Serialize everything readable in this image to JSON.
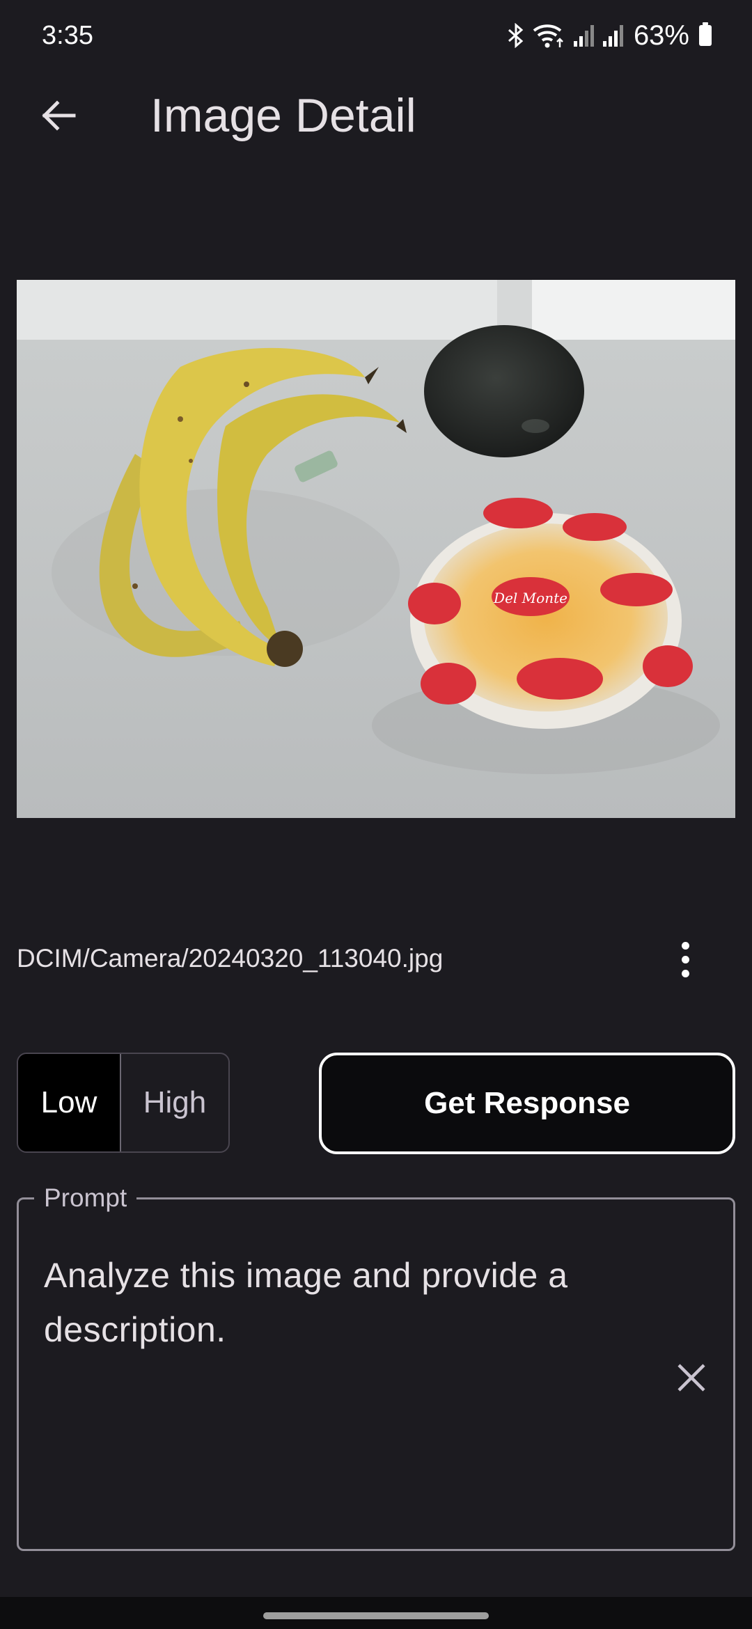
{
  "status_bar": {
    "time": "3:35",
    "battery": "63%",
    "icons": [
      "bluetooth-icon",
      "wifi-icon",
      "signal-icon",
      "signal-icon",
      "battery-icon"
    ]
  },
  "app_bar": {
    "title": "Image Detail",
    "back_icon": "arrow-back-icon"
  },
  "image": {
    "file_path": "DCIM/Camera/20240320_113040.jpg",
    "brand_label": "Del Monte",
    "more_icon": "more-vert-icon"
  },
  "quality": {
    "options": [
      "Low",
      "High"
    ],
    "selected": "Low"
  },
  "actions": {
    "get_response_label": "Get Response"
  },
  "prompt": {
    "label": "Prompt",
    "value": "Analyze this image and provide a description.",
    "clear_icon": "close-icon"
  },
  "colors": {
    "background": "#1c1b20",
    "selected_segment": "#000000",
    "outline": "#938f99"
  }
}
